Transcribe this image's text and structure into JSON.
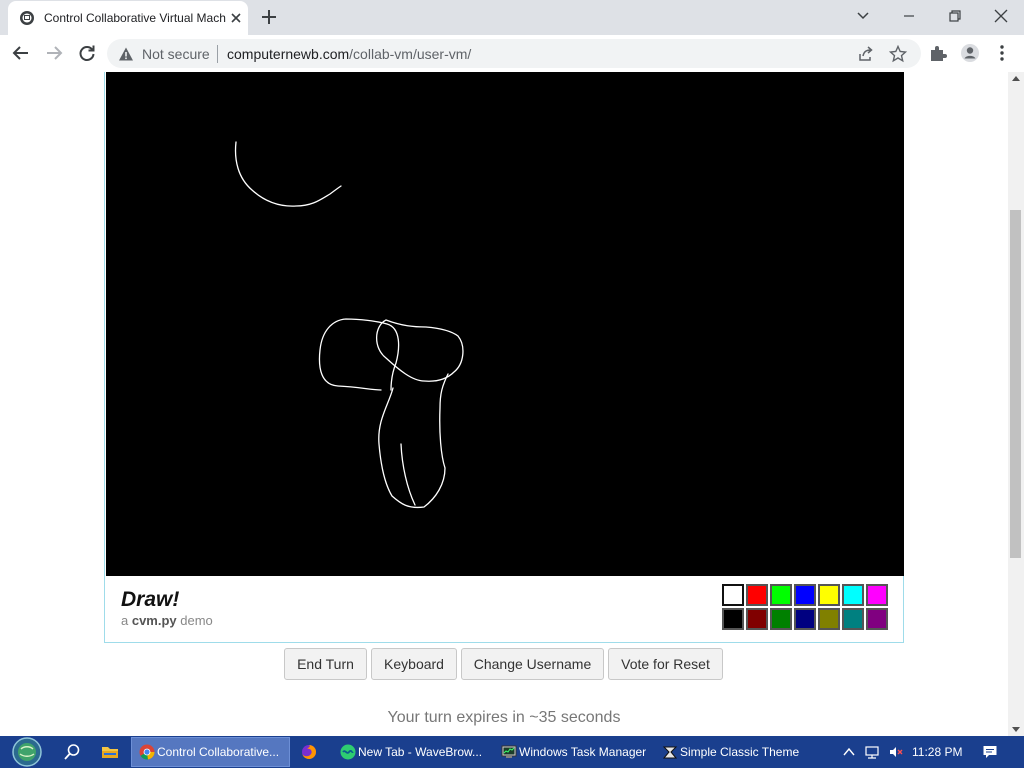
{
  "browser": {
    "tab": {
      "title": "Control Collaborative Virtual Machin",
      "favicon": "cvm-logo-icon"
    },
    "address": {
      "security_label": "Not secure",
      "url_host": "computernewb.com",
      "url_path": "/collab-vm/user-vm/"
    }
  },
  "vm": {
    "app_title": "Draw!",
    "subtitle_prefix": "a ",
    "subtitle_name": "cvm.py",
    "subtitle_suffix": " demo",
    "palette": {
      "row1": [
        "#ffffff",
        "#ff0000",
        "#00ff00",
        "#0000ff",
        "#ffff00",
        "#00ffff",
        "#ff00ff"
      ],
      "row2": [
        "#000000",
        "#800000",
        "#008000",
        "#000080",
        "#808000",
        "#008080",
        "#800080"
      ],
      "selected": "#ffffff"
    },
    "stroke_color": "#ffffff",
    "canvas_color": "#000000"
  },
  "controls": {
    "end_turn": "End Turn",
    "keyboard": "Keyboard",
    "change_username": "Change Username",
    "vote_reset": "Vote for Reset"
  },
  "status": {
    "turn_text": "Your turn expires in ~35 seconds"
  },
  "taskbar": {
    "tasks": [
      {
        "label": "Control Collaborative...",
        "icon": "chrome-icon",
        "active": true
      },
      {
        "label": "",
        "icon": "firefox-icon",
        "active": false
      },
      {
        "label": "New Tab - WaveBrow...",
        "icon": "wavebrowser-icon",
        "active": false
      },
      {
        "label": "Windows Task Manager",
        "icon": "task-manager-icon",
        "active": false
      },
      {
        "label": "Simple Classic Theme",
        "icon": "classic-theme-icon",
        "active": false
      }
    ],
    "clock": "11:28 PM"
  }
}
